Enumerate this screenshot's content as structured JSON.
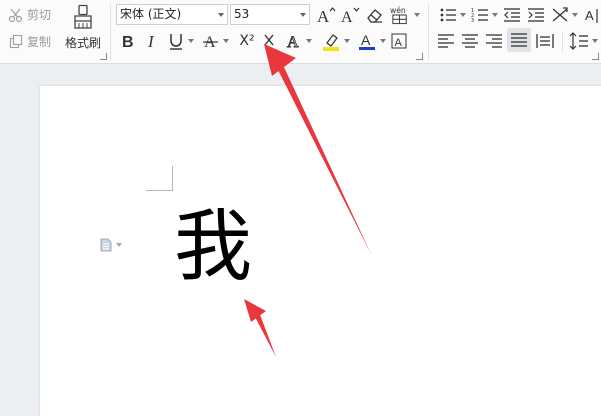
{
  "ribbon": {
    "clipboard": {
      "cut_label": "剪切",
      "copy_label": "复制",
      "format_painter_label": "格式刷"
    },
    "font": {
      "font_name": "宋体 (正文)",
      "font_size": "53",
      "superscript_glyph": "X²"
    },
    "accent_colors": {
      "font_color": "#1a3fd6",
      "highlight": "#f5e21b",
      "arrow": "#e8383d"
    }
  },
  "document": {
    "text": "我"
  }
}
